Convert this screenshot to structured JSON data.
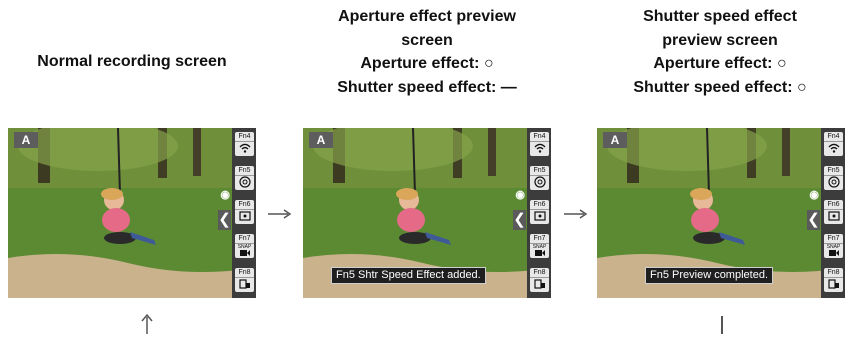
{
  "headings": {
    "normal": [
      "Normal recording screen"
    ],
    "aperture_preview": [
      "Aperture effect preview",
      "screen",
      "Aperture effect: ○",
      "Shutter speed effect: —"
    ],
    "shutter_preview": [
      "Shutter speed effect",
      "preview screen",
      "Aperture effect: ○",
      "Shutter speed effect: ○"
    ]
  },
  "screen": {
    "mode": "A",
    "fn_buttons": [
      "Fn4",
      "Fn5",
      "Fn6",
      "Fn7",
      "Fn8"
    ],
    "snap_label": "SNAP",
    "fn_icons": [
      "wifi-icon",
      "aperture-icon",
      "af-area-icon",
      "snap-movie-icon",
      "preview-icon"
    ]
  },
  "messages": {
    "aperture_preview": "Fn5 Shtr Speed Effect added.",
    "shutter_preview": "Fn5 Preview completed."
  }
}
